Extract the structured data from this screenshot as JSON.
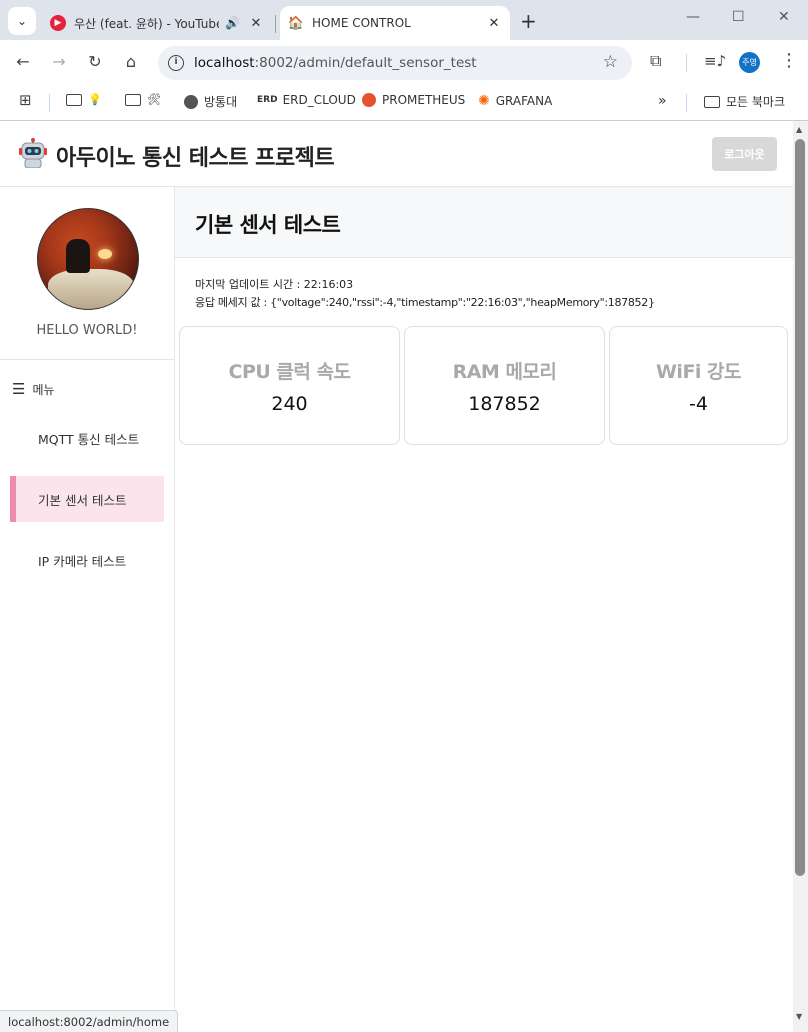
{
  "browser": {
    "tabs": [
      {
        "title": "우산 (feat. 윤하) - YouTube",
        "active": false,
        "icon": "youtube-music-icon"
      },
      {
        "title": "HOME CONTROL",
        "active": true,
        "icon": "home-favicon"
      }
    ],
    "url_host": "localhost",
    "url_path": ":8002/admin/default_sensor_test",
    "profile_label": "주영",
    "bookmarks": [
      {
        "label": "",
        "icon": "folder-icon",
        "emoji": "💡"
      },
      {
        "label": "",
        "icon": "folder-icon",
        "emoji": "🛠"
      },
      {
        "label": "방통대",
        "icon": "globe-icon"
      },
      {
        "label": "ERD_CLOUD",
        "icon": "erd-icon",
        "prefix": "ERD"
      },
      {
        "label": "PROMETHEUS",
        "icon": "prometheus-icon"
      },
      {
        "label": "GRAFANA",
        "icon": "grafana-icon"
      }
    ],
    "all_bookmarks_label": "모든 북마크",
    "status_url": "localhost:8002/admin/home"
  },
  "header": {
    "title": "아두이노 통신 테스트 프로젝트",
    "logout_label": "로그아웃"
  },
  "sidebar": {
    "greeting": "HELLO WORLD!",
    "menu_label": "메뉴",
    "items": [
      {
        "label": "MQTT 통신 테스트",
        "active": false
      },
      {
        "label": "기본 센서 테스트",
        "active": true
      },
      {
        "label": "IP 카메라 테스트",
        "active": false
      }
    ]
  },
  "main": {
    "title": "기본 센서 테스트",
    "update_time": "마지막 업데이트 시간 : 22:16:03",
    "response_message": "응답 메세지 값 : {\"voltage\":240,\"rssi\":-4,\"timestamp\":\"22:16:03\",\"heapMemory\":187852}",
    "cards": [
      {
        "label": "CPU 클럭 속도",
        "value": "240"
      },
      {
        "label": "RAM 메모리",
        "value": "187852"
      },
      {
        "label": "WiFi 강도",
        "value": "-4"
      }
    ]
  },
  "colors": {
    "active_nav_bg": "#fce4ec",
    "active_nav_border": "#f08bb0",
    "logout_bg": "#d8d8d8",
    "card_label": "#a9a9a9"
  }
}
